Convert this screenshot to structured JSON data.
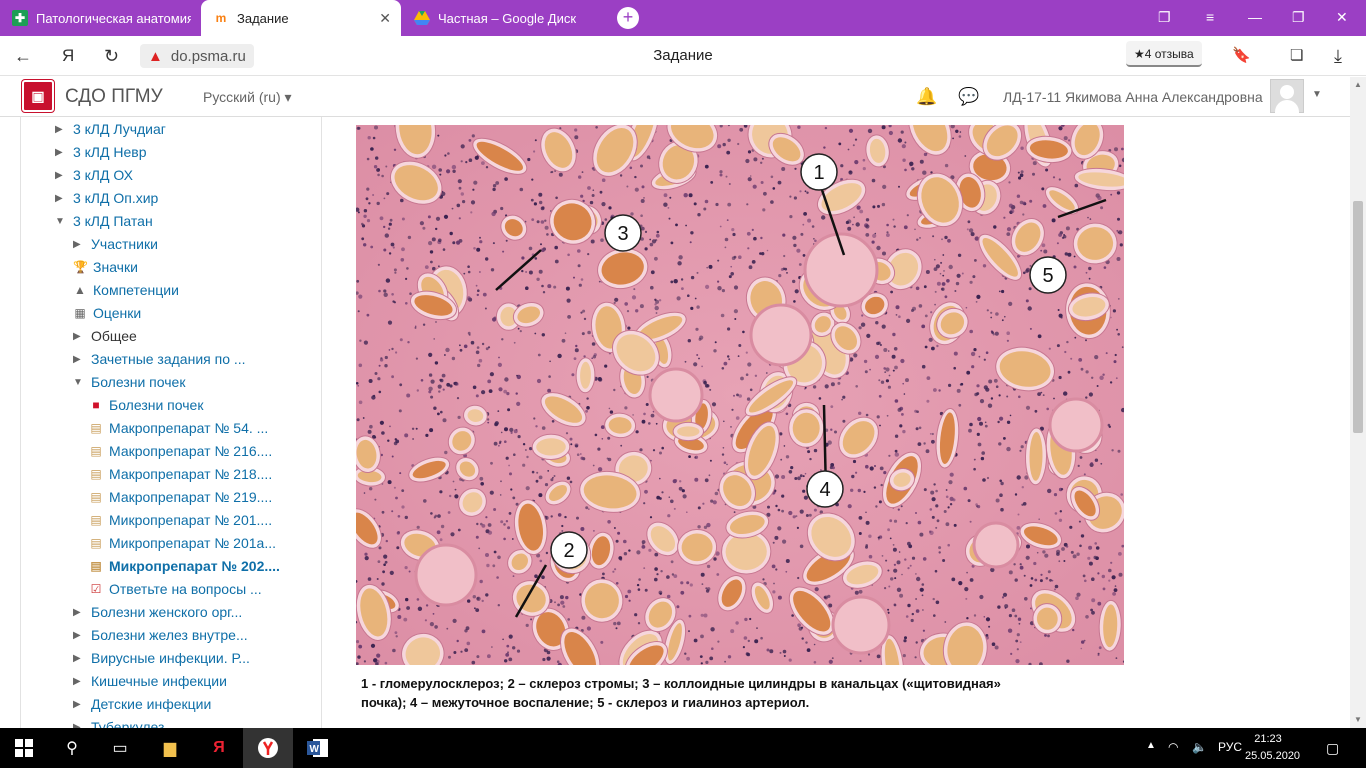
{
  "browser": {
    "tabs": [
      {
        "label": "Патологическая анатомия",
        "icon": "green-plus-icon",
        "active": false
      },
      {
        "label": "Задание",
        "icon": "moodle-icon",
        "active": true
      },
      {
        "label": "Частная – Google Диск",
        "icon": "google-drive-icon",
        "active": false
      }
    ],
    "new_tab_label": "+",
    "url": "do.psma.ru",
    "page_title": "Задание",
    "reviews_label": "4 отзыва",
    "yandex_glyph": "Я"
  },
  "site": {
    "name": "СДО ПГМУ",
    "language": "Русский (ru)",
    "user_name": "ЛД-17-11 Якимова Анна Александровна"
  },
  "sidebar": {
    "items": [
      {
        "label": "3 кЛД Лучдиаг",
        "arrow": "▶",
        "indent": 0
      },
      {
        "label": "3 кЛД Невр",
        "arrow": "▶",
        "indent": 0
      },
      {
        "label": "3 кЛД ОХ",
        "arrow": "▶",
        "indent": 0
      },
      {
        "label": "3 кЛД Оп.хир",
        "arrow": "▶",
        "indent": 0
      },
      {
        "label": "3 кЛД Патан",
        "arrow": "▼",
        "indent": 0
      },
      {
        "label": "Участники",
        "arrow": "▶",
        "indent": 1
      },
      {
        "label": "Значки",
        "icon": "trophy-icon",
        "indent": 1
      },
      {
        "label": "Компетенции",
        "icon": "competency-icon",
        "indent": 1
      },
      {
        "label": "Оценки",
        "icon": "grades-table-icon",
        "indent": 1
      },
      {
        "label": "Общее",
        "arrow": "▶",
        "indent": 1,
        "dark": true
      },
      {
        "label": "Зачетные задания по ...",
        "arrow": "▶",
        "indent": 1
      },
      {
        "label": "Болезни почек",
        "arrow": "▼",
        "indent": 1
      },
      {
        "label": "Болезни почек",
        "icon": "pdf-icon",
        "indent": 2
      },
      {
        "label": "Макропрепарат № 54. ...",
        "icon": "assignment-icon",
        "indent": 2
      },
      {
        "label": "Макропрепарат № 216....",
        "icon": "assignment-icon",
        "indent": 2
      },
      {
        "label": "Макропрепарат № 218....",
        "icon": "assignment-icon",
        "indent": 2
      },
      {
        "label": "Макропрепарат № 219....",
        "icon": "assignment-icon",
        "indent": 2
      },
      {
        "label": "Микропрепарат № 201....",
        "icon": "assignment-icon",
        "indent": 2
      },
      {
        "label": "Микропрепарат № 201а...",
        "icon": "assignment-icon",
        "indent": 2
      },
      {
        "label": "Микропрепарат № 202....",
        "icon": "assignment-icon",
        "indent": 2,
        "bold": true
      },
      {
        "label": "Ответьте на вопросы ...",
        "icon": "quiz-icon",
        "indent": 2
      },
      {
        "label": "Болезни женского орг...",
        "arrow": "▶",
        "indent": 1
      },
      {
        "label": "Болезни желез внутре...",
        "arrow": "▶",
        "indent": 1
      },
      {
        "label": "Вирусные инфекции. Р...",
        "arrow": "▶",
        "indent": 1
      },
      {
        "label": "Кишечные инфекции",
        "arrow": "▶",
        "indent": 1
      },
      {
        "label": "Детские инфекции",
        "arrow": "▶",
        "indent": 1
      },
      {
        "label": "Туберкулез",
        "arrow": "▶",
        "indent": 1
      }
    ]
  },
  "content": {
    "markers": [
      "1",
      "2",
      "3",
      "4",
      "5"
    ],
    "caption_line1": "1 - гломерулосклероз; 2 – склероз стромы; 3 – коллоидные цилиндры в канальцах («щитовидная»",
    "caption_line2": "почка);  4 – межуточное воспаление;  5 - склероз и гиалиноз артериол."
  },
  "taskbar": {
    "language": "РУС",
    "time": "21:23",
    "date": "25.05.2020"
  },
  "colors": {
    "tab_bar": "#9b3fc4",
    "link": "#0f6fa8",
    "tissue_pink": "#e8a0b0",
    "cast_orange": "#e3a060"
  }
}
